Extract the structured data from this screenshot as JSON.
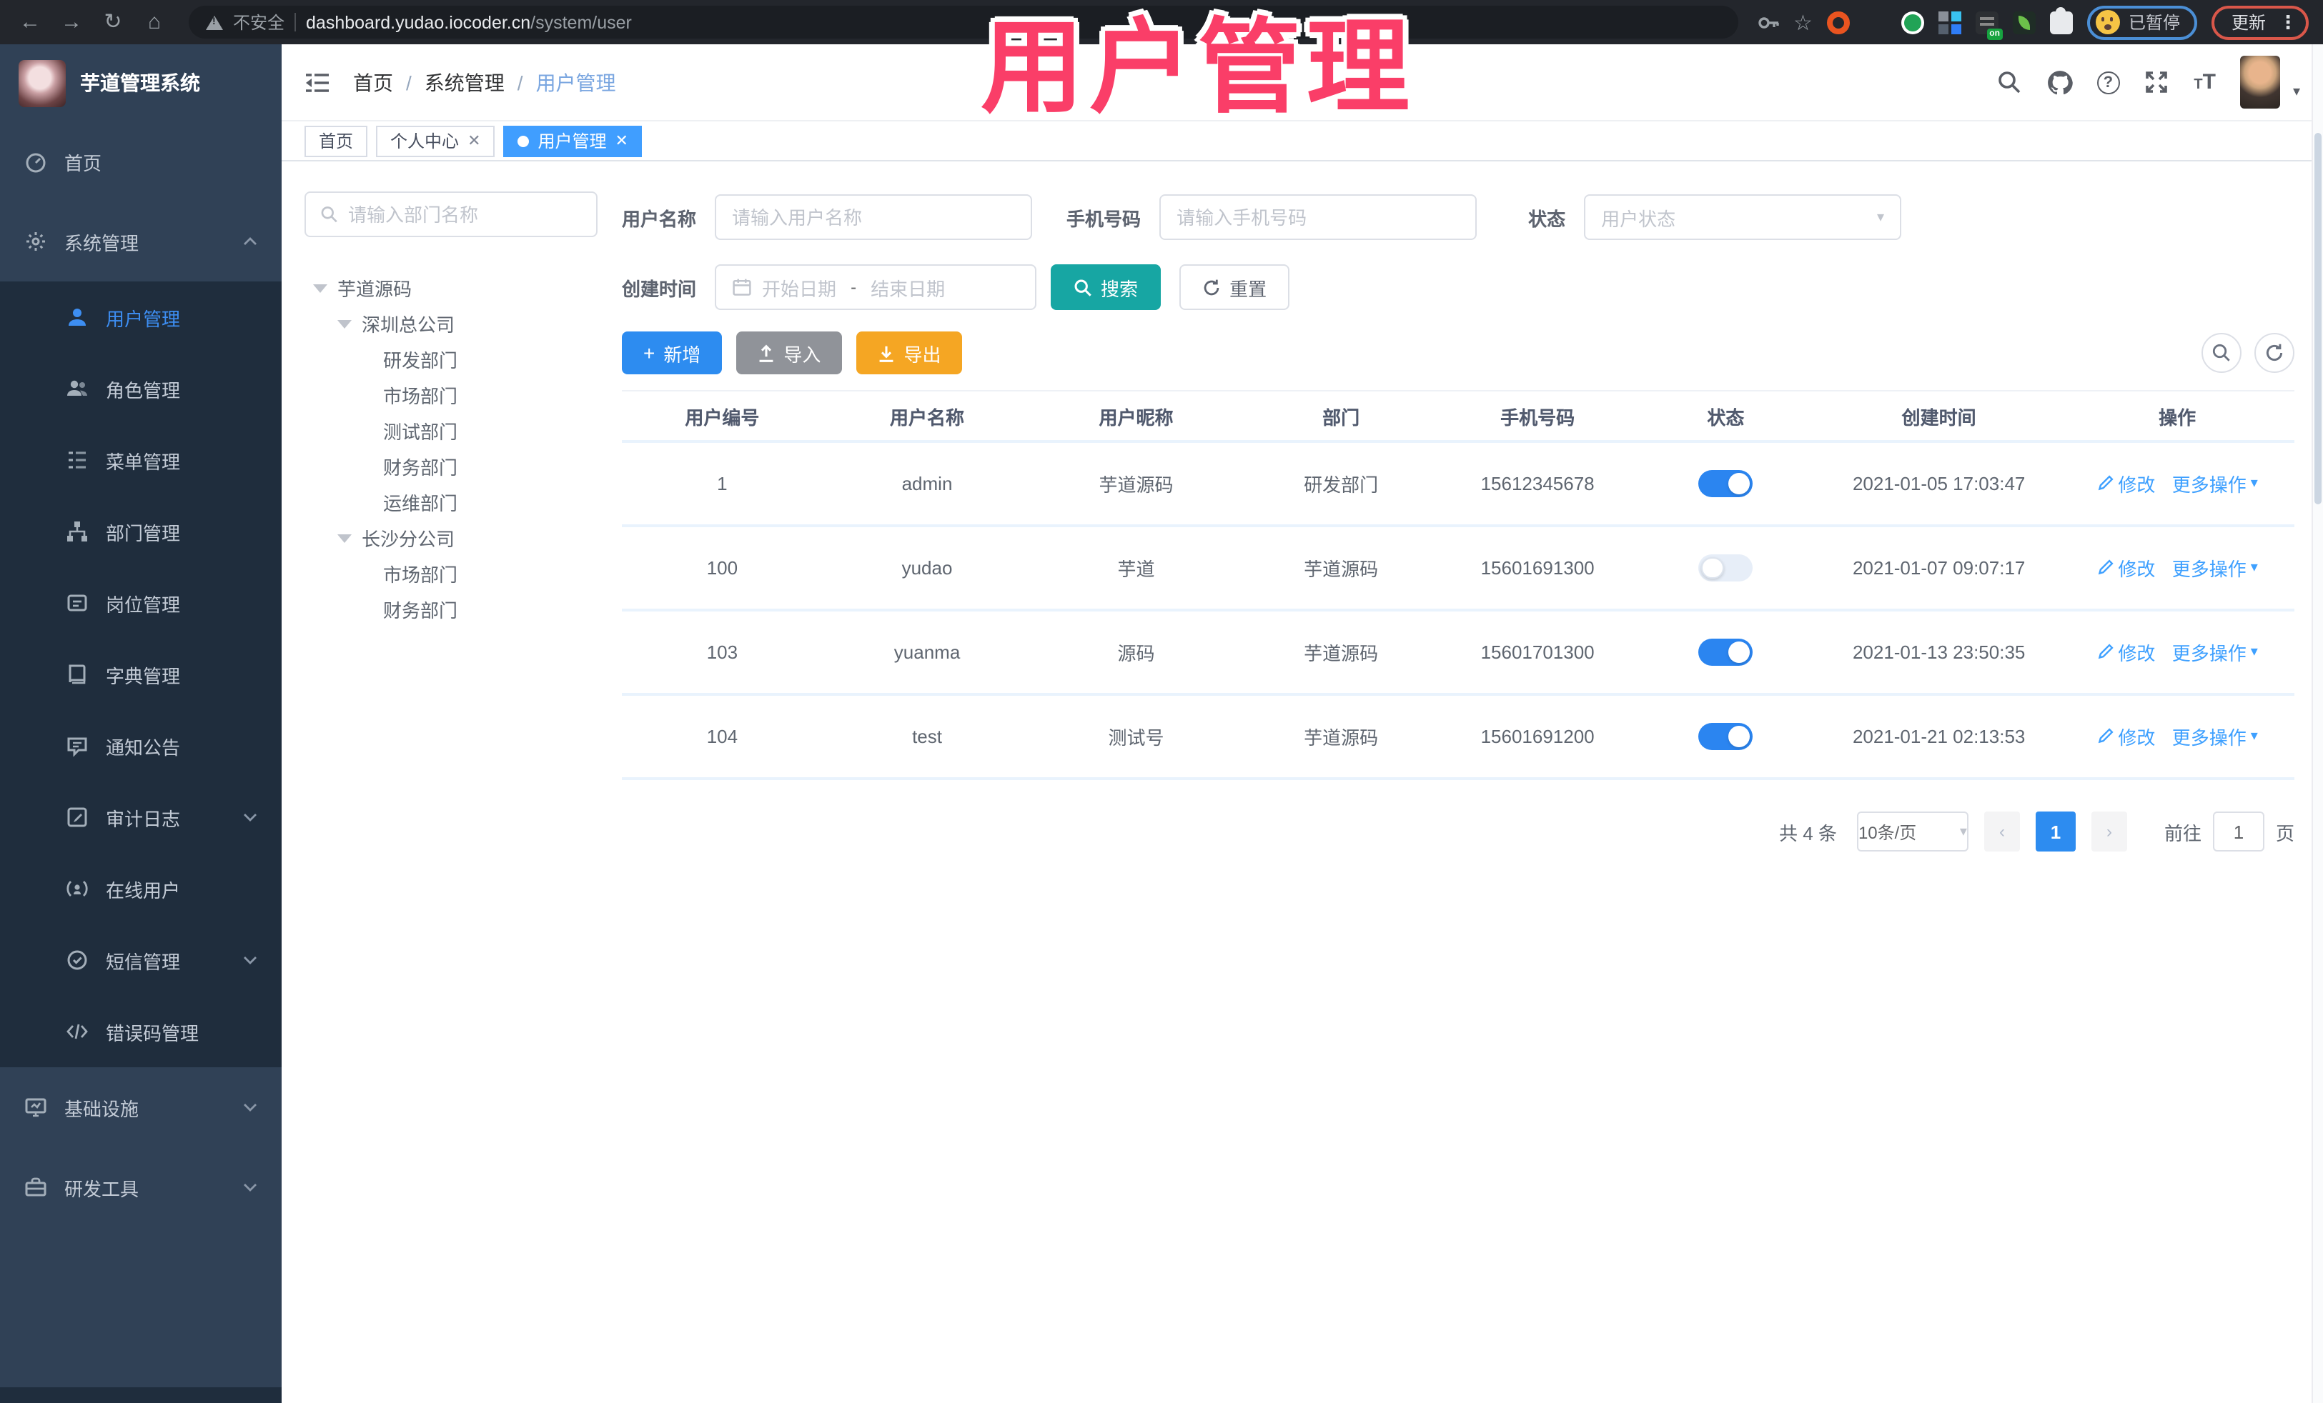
{
  "colors": {
    "accent_blue": "#409eff",
    "active_page_blue": "#2d8cf0",
    "teal_search": "#17a6a3",
    "export_orange": "#f5a623",
    "import_gray": "#909399",
    "sidebar_bg": "#304156",
    "submenu_bg": "#1f2d3d",
    "overlay_pink": "#fa3e68"
  },
  "overlay_title": "用户管理",
  "browser": {
    "security_label": "不安全",
    "url_domain": "dashboard.yudao.iocoder.cn",
    "url_path": "/system/user",
    "paused_label": "已暂停",
    "update_label": "更新"
  },
  "sidebar": {
    "app_title": "芋道管理系统",
    "items": [
      {
        "label": "首页"
      },
      {
        "label": "系统管理"
      },
      {
        "label": "用户管理"
      },
      {
        "label": "角色管理"
      },
      {
        "label": "菜单管理"
      },
      {
        "label": "部门管理"
      },
      {
        "label": "岗位管理"
      },
      {
        "label": "字典管理"
      },
      {
        "label": "通知公告"
      },
      {
        "label": "审计日志"
      },
      {
        "label": "在线用户"
      },
      {
        "label": "短信管理"
      },
      {
        "label": "错误码管理"
      },
      {
        "label": "基础设施"
      },
      {
        "label": "研发工具"
      }
    ]
  },
  "navbar": {
    "breadcrumb": [
      "首页",
      "系统管理",
      "用户管理"
    ],
    "separator": "/"
  },
  "tabs": [
    {
      "label": "首页"
    },
    {
      "label": "个人中心"
    },
    {
      "label": "用户管理"
    }
  ],
  "tree": {
    "search_placeholder": "请输入部门名称",
    "nodes": [
      "芋道源码",
      "深圳总公司",
      "研发部门",
      "市场部门",
      "测试部门",
      "财务部门",
      "运维部门",
      "长沙分公司",
      "市场部门",
      "财务部门"
    ]
  },
  "filters": {
    "username_label": "用户名称",
    "username_placeholder": "请输入用户名称",
    "mobile_label": "手机号码",
    "mobile_placeholder": "请输入手机号码",
    "status_label": "状态",
    "status_placeholder": "用户状态",
    "created_label": "创建时间",
    "date_start": "开始日期",
    "date_sep": "-",
    "date_end": "结束日期",
    "search_label": "搜索",
    "reset_label": "重置"
  },
  "toolbar": {
    "add_label": "新增",
    "import_label": "导入",
    "export_label": "导出"
  },
  "table": {
    "columns": [
      "用户编号",
      "用户名称",
      "用户昵称",
      "部门",
      "手机号码",
      "状态",
      "创建时间",
      "操作"
    ],
    "actions": {
      "edit": "修改",
      "more": "更多操作"
    },
    "rows": [
      {
        "id": "1",
        "username": "admin",
        "nickname": "芋道源码",
        "dept": "研发部门",
        "mobile": "15612345678",
        "status": "on",
        "created": "2021-01-05 17:03:47"
      },
      {
        "id": "100",
        "username": "yudao",
        "nickname": "芋道",
        "dept": "芋道源码",
        "mobile": "15601691300",
        "status": "off",
        "created": "2021-01-07 09:07:17"
      },
      {
        "id": "103",
        "username": "yuanma",
        "nickname": "源码",
        "dept": "芋道源码",
        "mobile": "15601701300",
        "status": "on",
        "created": "2021-01-13 23:50:35"
      },
      {
        "id": "104",
        "username": "test",
        "nickname": "测试号",
        "dept": "芋道源码",
        "mobile": "15601691200",
        "status": "on",
        "created": "2021-01-21 02:13:53"
      }
    ]
  },
  "pagination": {
    "total": "共 4 条",
    "page_size": "10条/页",
    "page": "1",
    "goto_label": "前往",
    "goto_value": "1",
    "page_unit": "页"
  }
}
